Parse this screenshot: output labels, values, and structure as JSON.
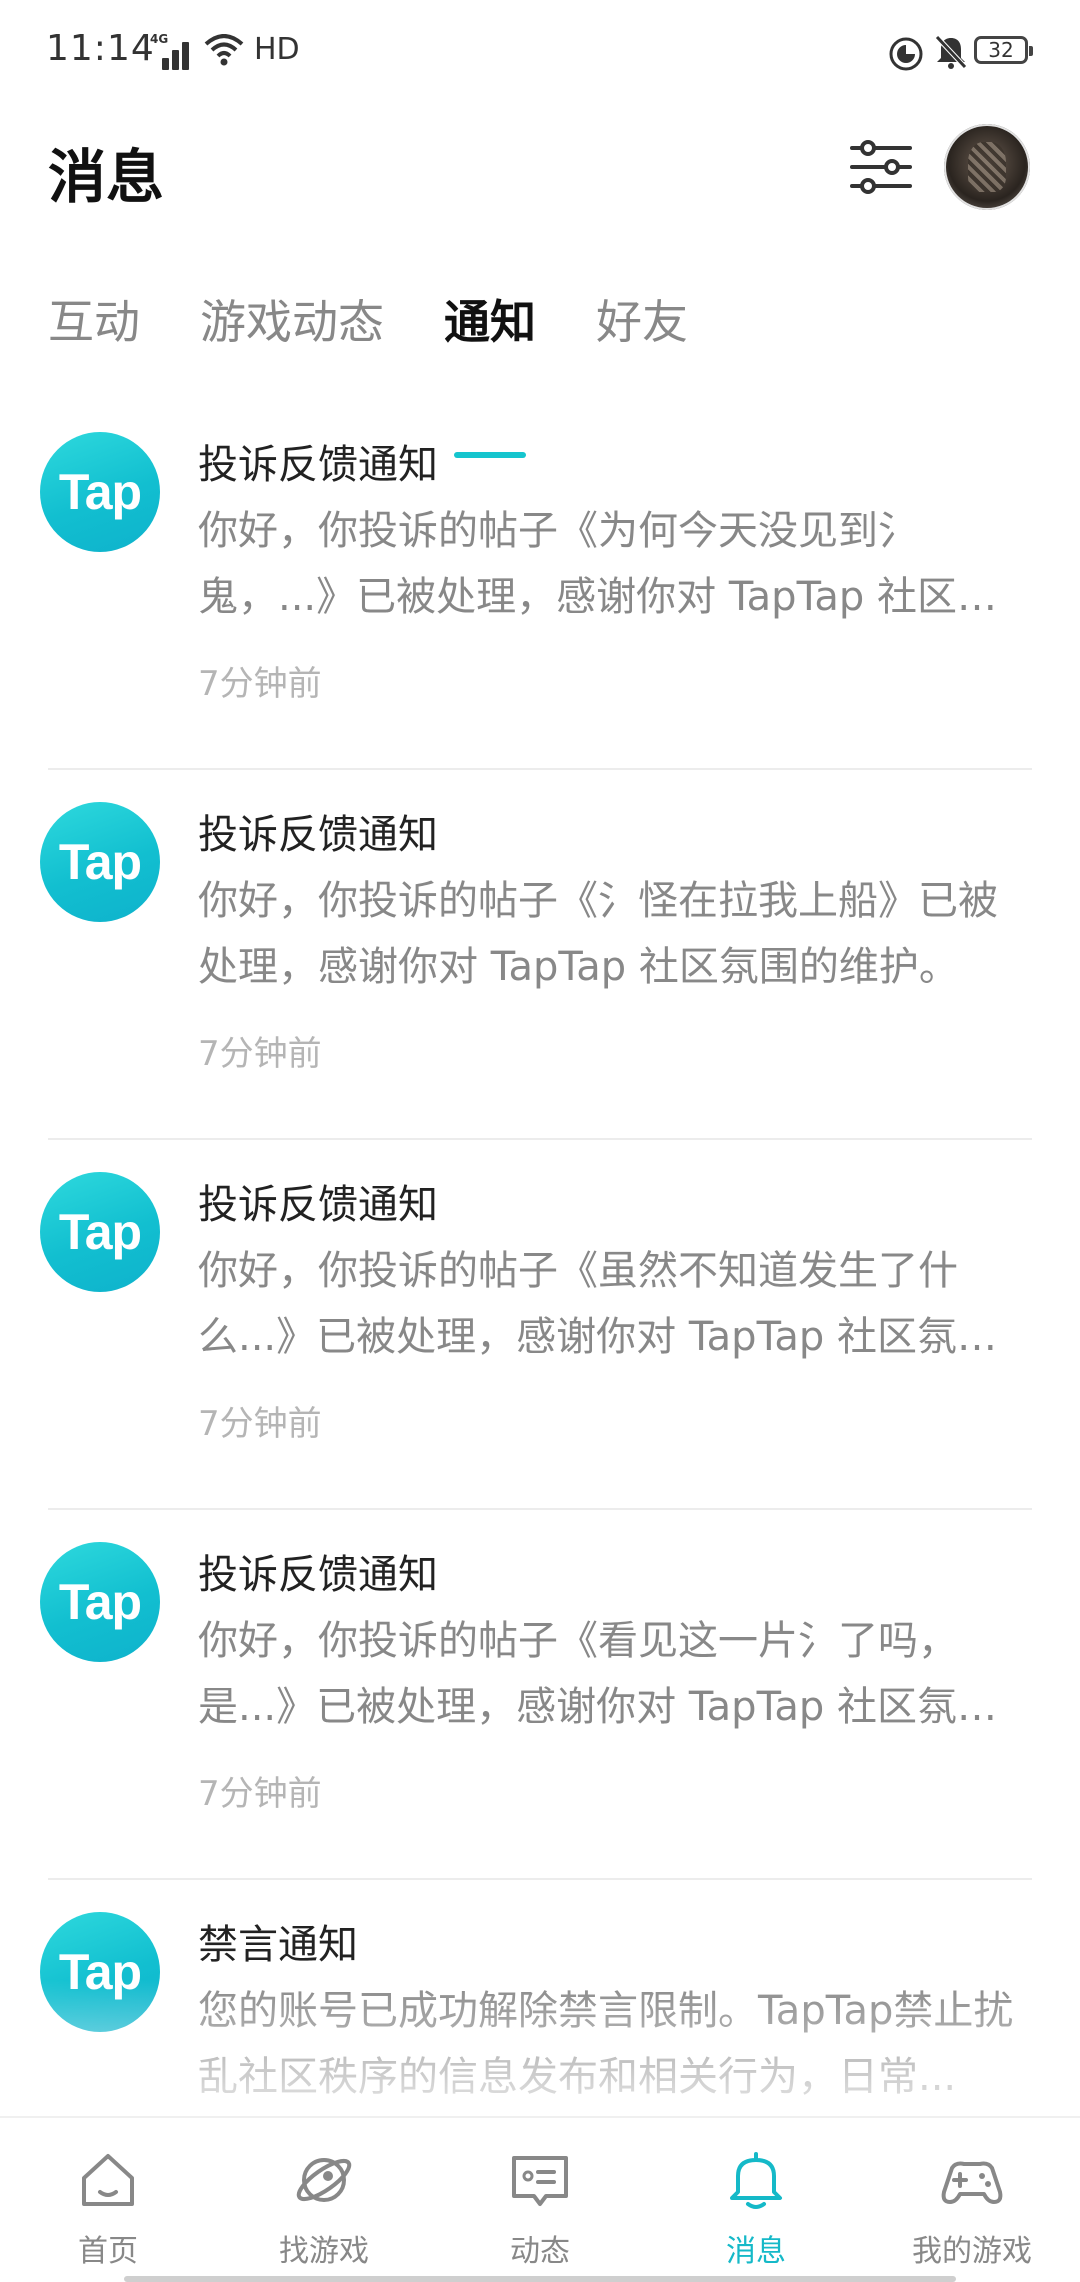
{
  "status_bar": {
    "time": "11:14",
    "network": "4G",
    "hd": "HD",
    "battery": "32"
  },
  "header": {
    "title": "消息"
  },
  "tabs": [
    {
      "label": "互动",
      "active": false
    },
    {
      "label": "游戏动态",
      "active": false
    },
    {
      "label": "通知",
      "active": true
    },
    {
      "label": "好友",
      "active": false
    }
  ],
  "notifications": [
    {
      "logo_text": "Tap",
      "title": "投诉反馈通知",
      "body": "你好，你投诉的帖子《为何今天没见到氵鬼，...》已被处理，感谢你对 TapTap 社区氛围的维护。",
      "time": "7分钟前"
    },
    {
      "logo_text": "Tap",
      "title": "投诉反馈通知",
      "body": "你好，你投诉的帖子《氵怪在拉我上船》已被处理，感谢你对 TapTap 社区氛围的维护。",
      "time": "7分钟前"
    },
    {
      "logo_text": "Tap",
      "title": "投诉反馈通知",
      "body": "你好，你投诉的帖子《虽然不知道发生了什么...》已被处理，感谢你对 TapTap 社区氛围的维护。",
      "time": "7分钟前"
    },
    {
      "logo_text": "Tap",
      "title": "投诉反馈通知",
      "body": "你好，你投诉的帖子《看见这一片氵了吗，是...》已被处理，感谢你对 TapTap 社区氛围的维护。",
      "time": "7分钟前"
    },
    {
      "logo_text": "Tap",
      "title": "禁言通知",
      "body": "您的账号已成功解除禁言限制。TapTap禁止扰乱社区秩序的信息发布和相关行为，日常...",
      "time": ""
    }
  ],
  "bottom_nav": [
    {
      "label": "首页",
      "icon": "home-icon",
      "active": false
    },
    {
      "label": "找游戏",
      "icon": "planet-icon",
      "active": false
    },
    {
      "label": "动态",
      "icon": "feed-icon",
      "active": false
    },
    {
      "label": "消息",
      "icon": "bell-icon",
      "active": true
    },
    {
      "label": "我的游戏",
      "icon": "gamepad-icon",
      "active": false
    }
  ],
  "colors": {
    "accent": "#15c5ce",
    "logo_gradient_start": "#2ed9dd",
    "logo_gradient_end": "#0eb2cc"
  }
}
